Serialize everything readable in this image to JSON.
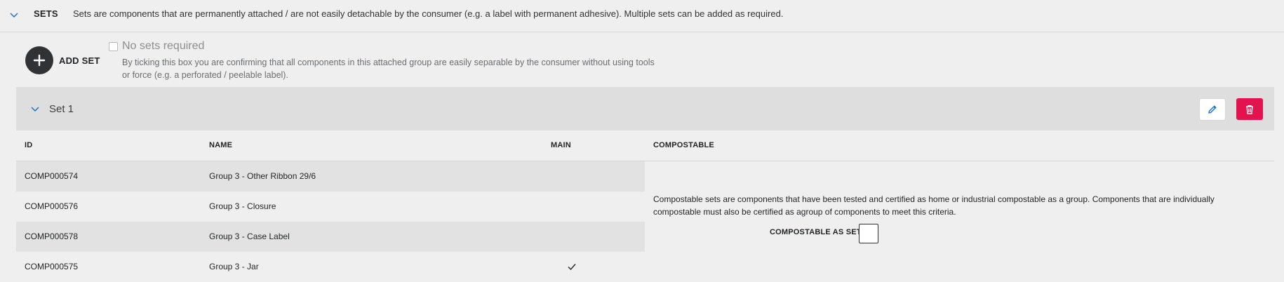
{
  "sets_section": {
    "title": "SETS",
    "description": "Sets are components that are permanently attached / are not easily detachable by the consumer (e.g. a label with permanent adhesive). Multiple sets can be added as required."
  },
  "add_set": {
    "label": "ADD SET"
  },
  "no_sets": {
    "label": "No sets required",
    "checked": false,
    "help": "By ticking this box you are confirming that all components in this attached group are easily separable by the consumer without using tools or force (e.g. a perforated / peelable label)."
  },
  "set": {
    "title": "Set 1",
    "columns": {
      "id": "ID",
      "name": "NAME",
      "main": "MAIN",
      "compostable": "COMPOSTABLE"
    },
    "rows": [
      {
        "id": "COMP000574",
        "name": "Group 3 - Other Ribbon 29/6",
        "main": false
      },
      {
        "id": "COMP000576",
        "name": "Group 3 - Closure",
        "main": false
      },
      {
        "id": "COMP000578",
        "name": "Group 3 - Case Label",
        "main": false
      },
      {
        "id": "COMP000575",
        "name": "Group 3 - Jar",
        "main": true
      }
    ],
    "compostable_text": "Compostable sets are components that have been tested and certified as home or industrial compostable as a group. Components that are individually compostable must also be certified as agroup of components to meet this criteria.",
    "compostable_label": "COMPOSTABLE AS SET",
    "compostable_checked": false
  },
  "colors": {
    "accent": "#1a73c8",
    "danger": "#e2134f",
    "dark": "#2f3336"
  },
  "icons": {
    "collapse": "chevron-down-icon",
    "add": "plus-icon",
    "edit": "pencil-icon",
    "delete": "trash-icon",
    "main": "checkmark-icon"
  }
}
